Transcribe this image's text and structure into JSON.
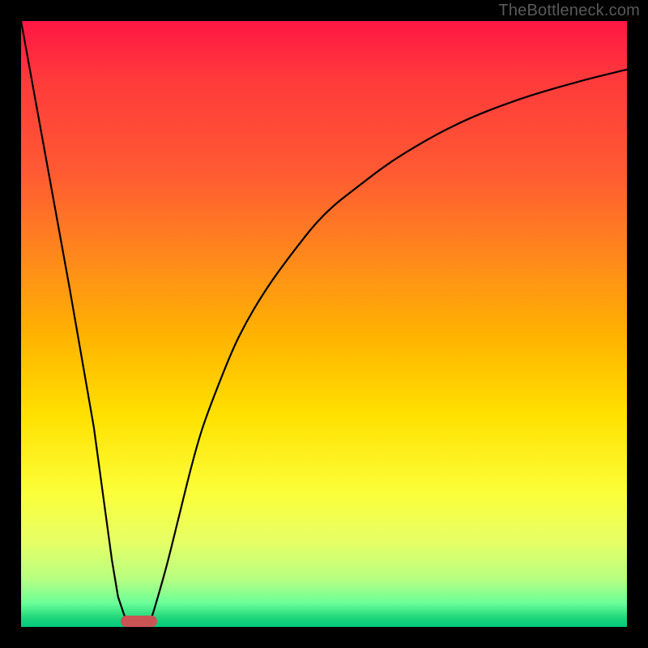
{
  "watermark": "TheBottleneck.com",
  "chart_data": {
    "type": "line",
    "title": "",
    "xlabel": "",
    "ylabel": "",
    "xlim": [
      0,
      100
    ],
    "ylim": [
      0,
      100
    ],
    "series": [
      {
        "name": "left-branch",
        "x": [
          0,
          4,
          8,
          12,
          15,
          16,
          17,
          18
        ],
        "y": [
          100,
          78,
          56,
          33,
          11,
          5,
          2,
          0
        ]
      },
      {
        "name": "right-branch",
        "x": [
          21,
          22,
          24,
          26,
          28,
          30,
          33,
          36,
          40,
          45,
          50,
          56,
          63,
          72,
          82,
          92,
          100
        ],
        "y": [
          0,
          3,
          10,
          18,
          26,
          33,
          41,
          48,
          55,
          62,
          68,
          73,
          78,
          83,
          87,
          90,
          92
        ]
      }
    ],
    "marker": {
      "name": "optimal-range",
      "x_start": 16.5,
      "x_end": 22.5,
      "y": 0
    },
    "background": {
      "type": "vertical-gradient",
      "stops": [
        {
          "pos": 0.0,
          "color": "#ff1744"
        },
        {
          "pos": 0.4,
          "color": "#ff8c1a"
        },
        {
          "pos": 0.65,
          "color": "#ffe100"
        },
        {
          "pos": 0.96,
          "color": "#6dff99"
        },
        {
          "pos": 1.0,
          "color": "#00c97e"
        }
      ]
    }
  }
}
